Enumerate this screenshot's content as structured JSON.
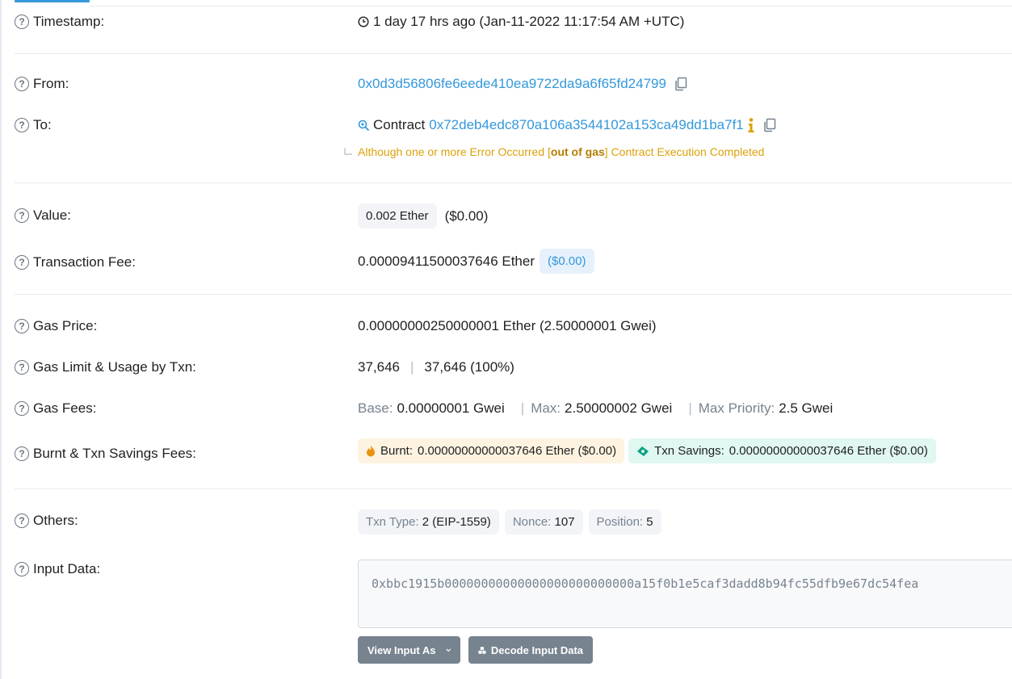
{
  "rows": {
    "timestamp": {
      "label": "Timestamp:",
      "value": "1 day 17 hrs ago (Jan-11-2022 11:17:54 AM +UTC)"
    },
    "from": {
      "label": "From:",
      "address": "0x0d3d56806fe6eede410ea9722da9a6f65fd24799"
    },
    "to": {
      "label": "To:",
      "prefix": "Contract",
      "address": "0x72deb4edc870a106a3544102a153ca49dd1ba7f1",
      "warning_pre": "Although one or more Error Occurred [",
      "warning_bold": "out of gas",
      "warning_post": "] Contract Execution Completed"
    },
    "value": {
      "label": "Value:",
      "badge": "0.002 Ether",
      "usd": "($0.00)"
    },
    "fee": {
      "label": "Transaction Fee:",
      "amount": "0.00009411500037646 Ether",
      "usd": "($0.00)"
    },
    "gas_price": {
      "label": "Gas Price:",
      "value": "0.00000000250000001 Ether (2.50000001 Gwei)"
    },
    "gas_limit": {
      "label": "Gas Limit & Usage by Txn:",
      "limit": "37,646",
      "separator": "|",
      "usage": "37,646 (100%)"
    },
    "gas_fees": {
      "label": "Gas Fees:",
      "base_label": "Base:",
      "base_value": "0.00000001 Gwei",
      "separator": "|",
      "max_label": "Max:",
      "max_value": "2.50000002 Gwei",
      "priority_label": "Max Priority:",
      "priority_value": "2.5 Gwei"
    },
    "burnt": {
      "label": "Burnt & Txn Savings Fees:",
      "burnt_label": "Burnt:",
      "burnt_value": "0.00000000000037646 Ether ($0.00)",
      "savings_label": "Txn Savings:",
      "savings_value": "0.00000000000037646 Ether ($0.00)"
    },
    "others": {
      "label": "Others:",
      "type_label": "Txn Type:",
      "type_value": "2 (EIP-1559)",
      "nonce_label": "Nonce:",
      "nonce_value": "107",
      "position_label": "Position:",
      "position_value": "5"
    },
    "input": {
      "label": "Input Data:",
      "data": "0xbbc1915b00000000000000000000000000a15f0b1e5caf3dadd8b94fc55dfb9e67dc54fea",
      "view_as_label": "View Input As",
      "decode_label": "Decode Input Data"
    }
  },
  "help_glyph": "?",
  "icons": [
    "question-circle-icon",
    "clock-icon",
    "copy-icon",
    "contract-search-icon",
    "info-icon",
    "fire-icon",
    "money-icon",
    "chevron-down-icon",
    "cubes-icon"
  ],
  "colors": {
    "link": "#3498db",
    "warning": "#dba10a",
    "muted": "#77838f",
    "button": "#77838f"
  }
}
